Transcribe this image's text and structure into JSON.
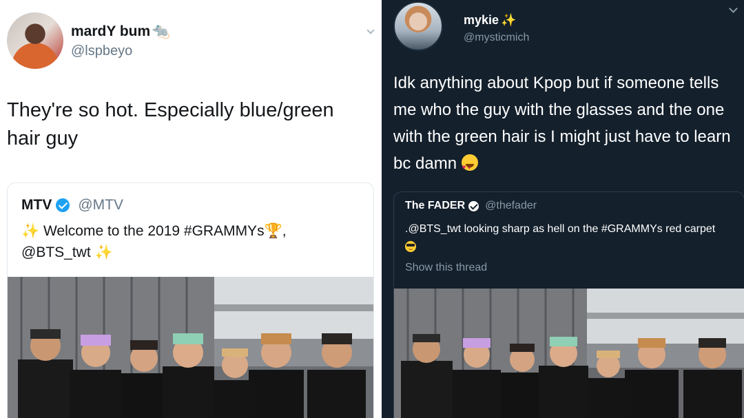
{
  "left_tweet": {
    "author_name": "mardY bum",
    "author_emoji": "🐀",
    "author_handle": "@lspbeyo",
    "text": "They're so hot. Especially blue/green hair guy",
    "quoted": {
      "name": "MTV",
      "handle": "@MTV",
      "sparkle": "✨",
      "text_main": " Welcome to the 2019 #GRAMMYs",
      "trophy": "🏆",
      "text_tail": ",",
      "line2": "@BTS_twt"
    }
  },
  "right_tweet": {
    "author_name": "mykie",
    "author_emoji": "✨",
    "author_handle": "@mysticmich",
    "text": "Idk anything about Kpop but if someone tells me who the guy with the glasses and the one with the green hair is I might just have to learn bc  damn",
    "quoted": {
      "name": "The FADER",
      "handle": "@thefader",
      "text": ".@BTS_twt looking sharp as hell on the #GRAMMYs red carpet",
      "show_thread": "Show this thread"
    }
  },
  "colors": {
    "light_bg": "#ffffff",
    "dark_bg": "#14202c",
    "twitter_blue": "#1da1f2",
    "muted_light": "#657786",
    "muted_dark": "#8899a6"
  }
}
